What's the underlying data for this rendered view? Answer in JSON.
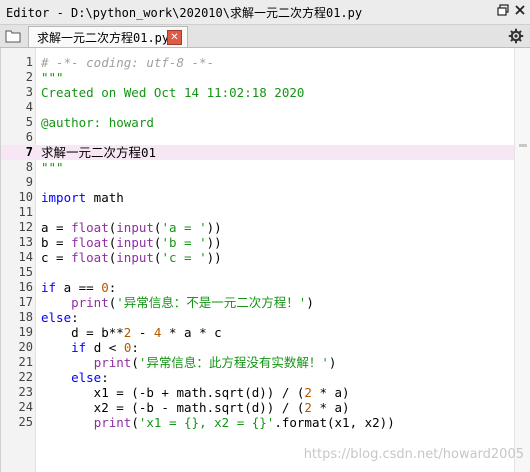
{
  "titlebar": {
    "title": "Editor - D:\\python_work\\202010\\求解一元二次方程01.py",
    "undock_icon": "undock-icon",
    "close_icon": "close-icon"
  },
  "tabs": [
    {
      "label": "求解一元二次方程01.py",
      "active": true
    }
  ],
  "toolbar": {
    "browse_icon": "browse-tabs-icon",
    "options_icon": "gear-icon"
  },
  "editor": {
    "current_line": 7,
    "lines": [
      {
        "n": "1",
        "tokens": [
          [
            "comment",
            "# -*- coding: utf-8 -*-"
          ]
        ]
      },
      {
        "n": "2",
        "tokens": [
          [
            "doc",
            "\"\"\""
          ]
        ]
      },
      {
        "n": "3",
        "tokens": [
          [
            "doc",
            "Created on Wed Oct 14 11:02:18 2020"
          ]
        ]
      },
      {
        "n": "4",
        "tokens": []
      },
      {
        "n": "5",
        "tokens": [
          [
            "doc",
            "@author: howard"
          ]
        ]
      },
      {
        "n": "6",
        "tokens": []
      },
      {
        "n": "7",
        "tokens": [
          [
            "plain",
            "求解一元二次方程01"
          ]
        ]
      },
      {
        "n": "8",
        "tokens": [
          [
            "doc",
            "\"\"\""
          ]
        ]
      },
      {
        "n": "9",
        "tokens": []
      },
      {
        "n": "10",
        "tokens": [
          [
            "kw",
            "import"
          ],
          [
            "plain",
            " math"
          ]
        ]
      },
      {
        "n": "11",
        "tokens": []
      },
      {
        "n": "12",
        "tokens": [
          [
            "plain",
            "a = "
          ],
          [
            "builtin",
            "float"
          ],
          [
            "plain",
            "("
          ],
          [
            "builtin",
            "input"
          ],
          [
            "plain",
            "("
          ],
          [
            "str",
            "'a = '"
          ],
          [
            "plain",
            "))"
          ]
        ]
      },
      {
        "n": "13",
        "tokens": [
          [
            "plain",
            "b = "
          ],
          [
            "builtin",
            "float"
          ],
          [
            "plain",
            "("
          ],
          [
            "builtin",
            "input"
          ],
          [
            "plain",
            "("
          ],
          [
            "str",
            "'b = '"
          ],
          [
            "plain",
            "))"
          ]
        ]
      },
      {
        "n": "14",
        "tokens": [
          [
            "plain",
            "c = "
          ],
          [
            "builtin",
            "float"
          ],
          [
            "plain",
            "("
          ],
          [
            "builtin",
            "input"
          ],
          [
            "plain",
            "("
          ],
          [
            "str",
            "'c = '"
          ],
          [
            "plain",
            "))"
          ]
        ]
      },
      {
        "n": "15",
        "tokens": []
      },
      {
        "n": "16",
        "tokens": [
          [
            "kw",
            "if"
          ],
          [
            "plain",
            " a == "
          ],
          [
            "num",
            "0"
          ],
          [
            "plain",
            ":"
          ]
        ]
      },
      {
        "n": "17",
        "tokens": [
          [
            "plain",
            "    "
          ],
          [
            "builtin",
            "print"
          ],
          [
            "plain",
            "("
          ],
          [
            "str",
            "'异常信息：不是一元二次方程！'"
          ],
          [
            "plain",
            ")"
          ]
        ]
      },
      {
        "n": "18",
        "tokens": [
          [
            "kw",
            "else"
          ],
          [
            "plain",
            ":"
          ]
        ]
      },
      {
        "n": "19",
        "tokens": [
          [
            "plain",
            "    d = b**"
          ],
          [
            "num",
            "2"
          ],
          [
            "plain",
            " - "
          ],
          [
            "num",
            "4"
          ],
          [
            "plain",
            " * a * c"
          ]
        ]
      },
      {
        "n": "20",
        "tokens": [
          [
            "plain",
            "    "
          ],
          [
            "kw",
            "if"
          ],
          [
            "plain",
            " d < "
          ],
          [
            "num",
            "0"
          ],
          [
            "plain",
            ":"
          ]
        ]
      },
      {
        "n": "21",
        "tokens": [
          [
            "plain",
            "       "
          ],
          [
            "builtin",
            "print"
          ],
          [
            "plain",
            "("
          ],
          [
            "str",
            "'异常信息：此方程没有实数解！'"
          ],
          [
            "plain",
            ")"
          ]
        ]
      },
      {
        "n": "22",
        "tokens": [
          [
            "plain",
            "    "
          ],
          [
            "kw",
            "else"
          ],
          [
            "plain",
            ":"
          ]
        ]
      },
      {
        "n": "23",
        "tokens": [
          [
            "plain",
            "       x1 = (-b + math.sqrt(d)) / ("
          ],
          [
            "num",
            "2"
          ],
          [
            "plain",
            " * a)"
          ]
        ]
      },
      {
        "n": "24",
        "tokens": [
          [
            "plain",
            "       x2 = (-b - math.sqrt(d)) / ("
          ],
          [
            "num",
            "2"
          ],
          [
            "plain",
            " * a)"
          ]
        ]
      },
      {
        "n": "25",
        "tokens": [
          [
            "plain",
            "       "
          ],
          [
            "builtin",
            "print"
          ],
          [
            "plain",
            "("
          ],
          [
            "str",
            "'x1 = {}, x2 = {}'"
          ],
          [
            "plain",
            ".format(x1, x2))"
          ]
        ]
      }
    ]
  },
  "watermark": "https://blog.csdn.net/howard2005"
}
